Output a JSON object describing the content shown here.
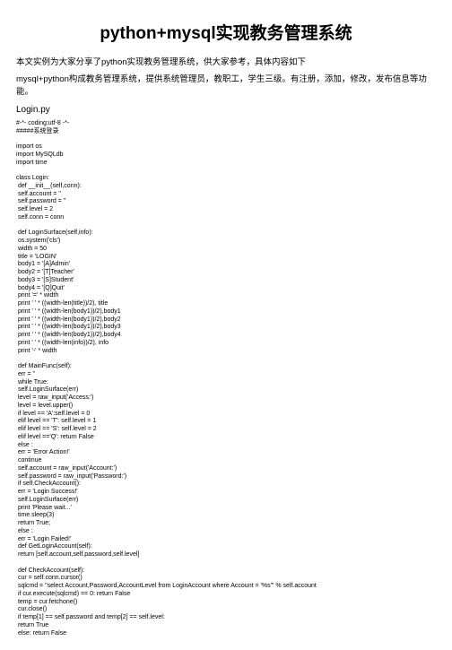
{
  "title": "python+mysql实现教务管理系统",
  "intro1": "本文实例为大家分享了python实现教务管理系统，供大家参考，具体内容如下",
  "intro2": "mysql+python构成教务管理系统，提供系统管理员，教职工，学生三级。有注册，添加，修改，发布信息等功能。",
  "filename": "Login.py",
  "code": "#-*- coding:utf-8 -*-\n#####系统登录\n\nimport os\nimport MySQLdb\nimport time\n\nclass Login:\n def __init__(self,conn):\n self.account = ''\n self.password = ''\n self.level = 2\n self.conn = conn\n\n def LoginSurface(self,info):\n os.system('cls')\n width = 50\n title = 'LOGIN'\n body1 = '[A]Admin'\n body2 = '[T]Teacher'\n body3 = '[S]Student'\n body4 = '[Q]Quit'\n print '=' * width\n print ' ' * ((width-len(title))/2), title\n print ' ' * ((width-len(body1))/2),body1\n print ' ' * ((width-len(body1))/2),body2\n print ' ' * ((width-len(body1))/2),body3\n print ' ' * ((width-len(body1))/2),body4\n print ' ' * ((width-len(info))/2), info\n print '-' * width\n\n def MainFunc(self):\n err = ''\n while True:\n self.LoginSurface(err)\n level = raw_input('Access:')\n level = level.upper()\n if level == 'A':self.level = 0\n elif level == 'T': self.level = 1\n elif level == 'S': self.level = 2\n elif level =='Q': return False\n else :\n err = 'Error Action!'\n continue\n self.account = raw_input('Account:')\n self.password = raw_input('Password:')\n if self.CheckAccount():\n err = 'Login Success!'\n self.LoginSurface(err)\n print 'Please wait...'\n time.sleep(3)\n return True;\n else :\n err = 'Login Failed!'\n def GetLoginAccount(self):\n return [self.account,self.password,self.level]\n\n def CheckAccount(self):\n cur = self.conn.cursor()\n sqlcmd = \"select Account,Password,AccountLevel from LoginAccount where Account = '%s'\" % self.account\n if cur.execute(sqlcmd) == 0: return False\n temp = cur.fetchone()\n cur.close()\n if temp[1] == self.password and temp[2] == self.level:\n return True\n else: return False"
}
